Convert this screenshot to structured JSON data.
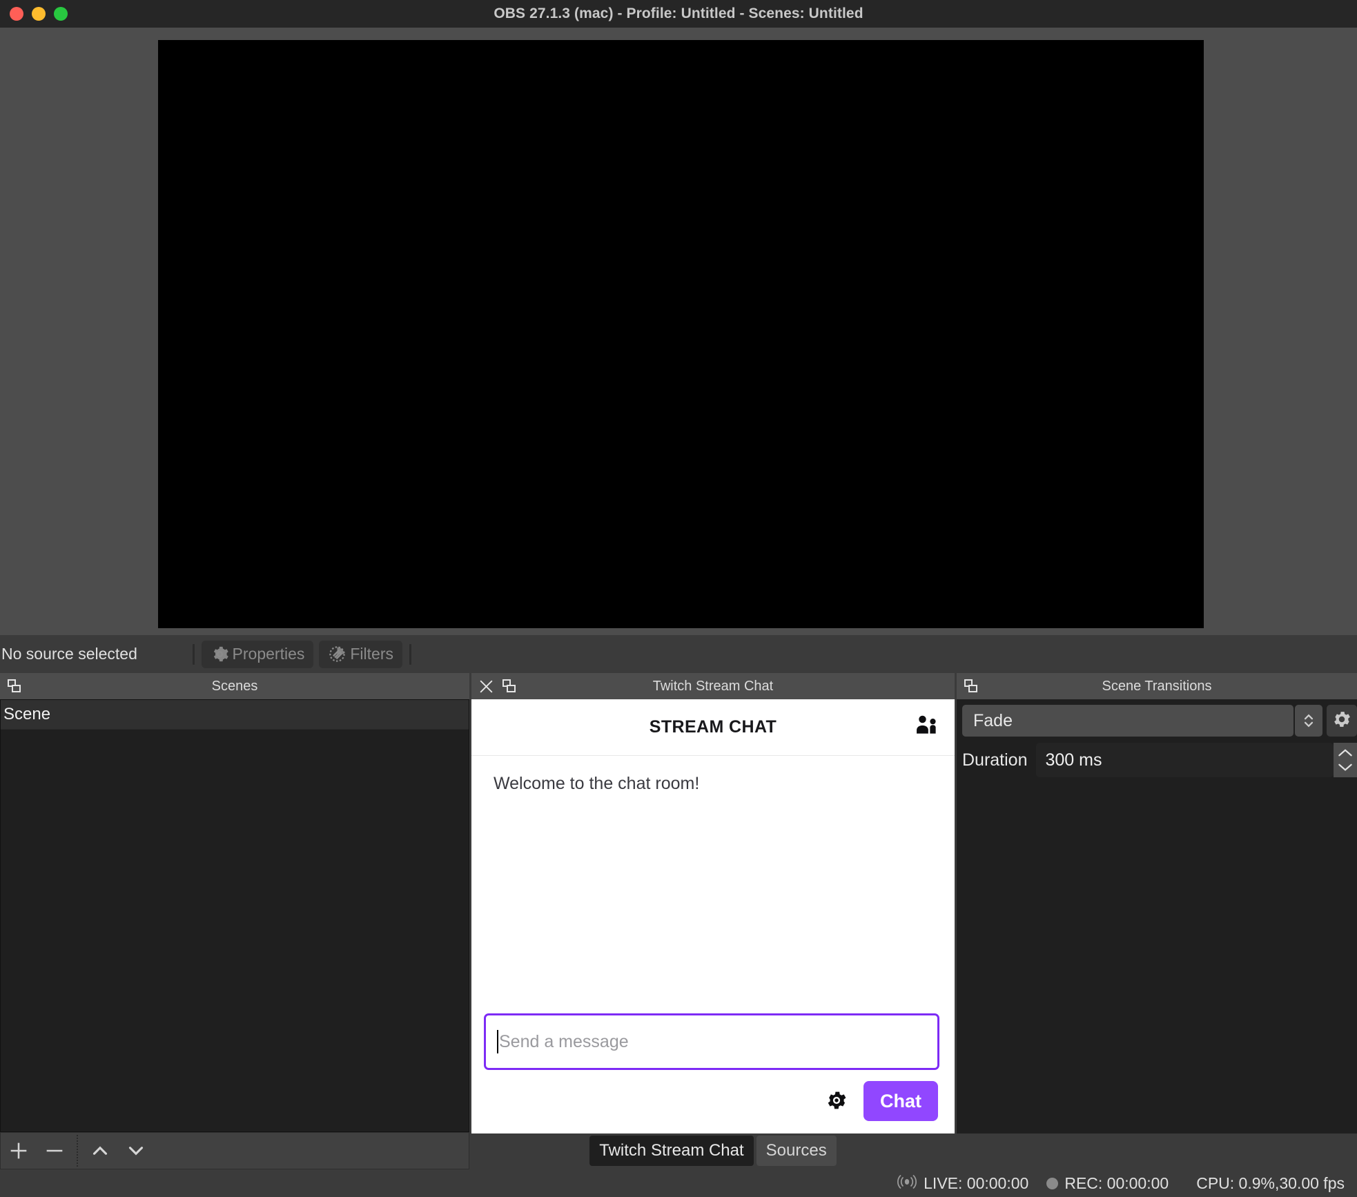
{
  "window": {
    "title": "OBS 27.1.3 (mac) - Profile: Untitled - Scenes: Untitled",
    "traffic_lights": {
      "close": "close-button",
      "minimize": "minimize-button",
      "zoom": "zoom-button"
    },
    "colors": {
      "titlebar_bg": "#262626",
      "app_bg": "#3b3b3b",
      "preview_bg": "#4d4d4d",
      "canvas_bg": "#000000",
      "twitch_purple": "#9147ff",
      "input_border_purple": "#7d2bf5"
    }
  },
  "source_toolbar": {
    "status_label": "No source selected",
    "properties_label": "Properties",
    "filters_label": "Filters",
    "properties_icon": "gear-icon",
    "filters_icon": "filters-icon"
  },
  "scenes_dock": {
    "title": "Scenes",
    "float_icon": "undock-icon",
    "items": [
      {
        "label": "Scene",
        "selected": true
      }
    ],
    "toolbar": {
      "add": "+",
      "remove": "−",
      "move_up": "chevron-up-icon",
      "move_down": "chevron-down-icon"
    }
  },
  "chat_dock": {
    "title": "Twitch Stream Chat",
    "close_icon": "close-icon",
    "float_icon": "undock-icon",
    "panel": {
      "header_title": "STREAM CHAT",
      "community_icon": "community-users-icon",
      "messages": [
        "Welcome to the chat room!"
      ],
      "input_placeholder": "Send a message",
      "input_value": "",
      "settings_icon": "gear-icon",
      "send_label": "Chat"
    },
    "tabs": [
      {
        "label": "Twitch Stream Chat",
        "active": true
      },
      {
        "label": "Sources",
        "active": false
      }
    ]
  },
  "transitions_dock": {
    "title": "Scene Transitions",
    "float_icon": "undock-icon",
    "transition_value": "Fade",
    "transition_options": [
      "Fade"
    ],
    "duration_label": "Duration",
    "duration_value": "300 ms",
    "properties_icon": "gear-icon",
    "stepper_icon": "updown-stepper-icon"
  },
  "statusbar": {
    "live_icon": "broadcast-icon",
    "live_label": "LIVE: 00:00:00",
    "rec_icon": "record-dot-icon",
    "rec_label": "REC: 00:00:00",
    "cpu_label": "CPU: 0.9%,30.00 fps"
  }
}
